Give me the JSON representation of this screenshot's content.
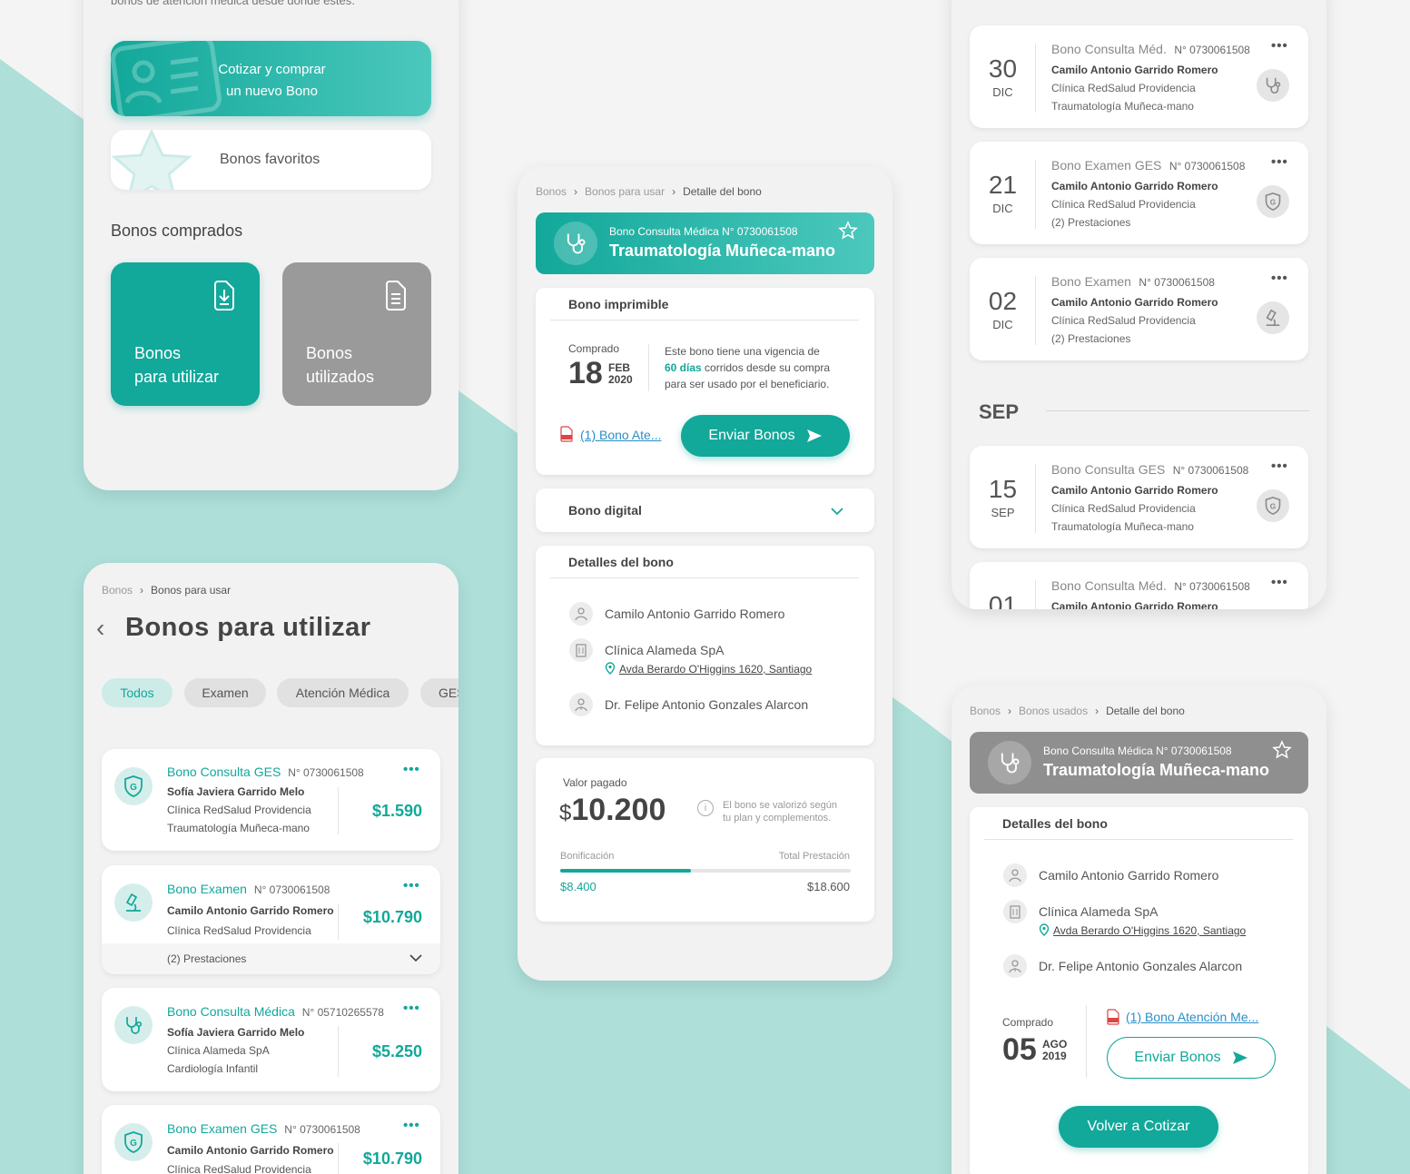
{
  "colors": {
    "accent": "#12a89a",
    "mint_bg": "#aedfd9",
    "grey_card": "#9a9a9a",
    "link": "#2a8fc7"
  },
  "home": {
    "intro_fragment": "bonos de atención médica desde donde estés.",
    "cotizar_line1": "Cotizar y comprar",
    "cotizar_line2": "un nuevo Bono",
    "favoritos": "Bonos favoritos",
    "comprados_title": "Bonos comprados",
    "tile_utilizar_1": "Bonos",
    "tile_utilizar_2": "para utilizar",
    "tile_utilizados_1": "Bonos",
    "tile_utilizados_2": "utilizados"
  },
  "list": {
    "breadcrumb": [
      "Bonos",
      "Bonos para usar"
    ],
    "title": "Bonos para utilizar",
    "chips": [
      "Todos",
      "Examen",
      "Atención Médica",
      "GES"
    ],
    "items": [
      {
        "type": "Bono Consulta GES",
        "num": "N° 0730061508",
        "person": "Sofía Javiera Garrido Melo",
        "clinic": "Clínica RedSalud Providencia",
        "spec": "Traumatología Muñeca-mano",
        "price": "$1.590",
        "icon": "shield-g-icon"
      },
      {
        "type": "Bono Examen",
        "num": "N° 0730061508",
        "person": "Camilo Antonio Garrido Romero",
        "clinic": "Clínica RedSalud Providencia",
        "spec": "(2) Prestaciones",
        "price": "$10.790",
        "icon": "microscope-icon"
      },
      {
        "type": "Bono Consulta Médica",
        "num": "N° 05710265578",
        "person": "Sofía Javiera Garrido Melo",
        "clinic": "Clínica Alameda SpA",
        "spec": "Cardiología Infantil",
        "price": "$5.250",
        "icon": "stethoscope-icon"
      },
      {
        "type": "Bono Examen GES",
        "num": "N° 0730061508",
        "person": "Camilo Antonio Garrido Romero",
        "clinic": "Clínica RedSalud Providencia",
        "spec": "",
        "price": "$10.790",
        "icon": "shield-g-icon"
      }
    ]
  },
  "detail": {
    "breadcrumb": [
      "Bonos",
      "Bonos para usar",
      "Detalle del bono"
    ],
    "header_sub": "Bono Consulta Médica N° 0730061508",
    "header_title": "Traumatología Muñeca-mano",
    "imprimible": "Bono imprimible",
    "comprado": "Comprado",
    "day": "18",
    "month": "FEB",
    "year": "2020",
    "vig_1": "Este bono tiene una vigencia de",
    "vig_days": "60 días",
    "vig_2": " corridos desde su compra",
    "vig_3": "para ser usado por el beneficiario.",
    "pdf_link": "(1) Bono Ate...",
    "enviar": "Enviar Bonos",
    "digital": "Bono digital",
    "detalles": "Detalles del bono",
    "patient": "Camilo Antonio Garrido Romero",
    "clinic": "Clínica Alameda SpA",
    "address": "Avda Berardo O'Higgins 1620, Santiago",
    "doctor": "Dr. Felipe Antonio Gonzales Alarcon",
    "valor_label": "Valor pagado",
    "valor_currency": "$",
    "valor": "10.200",
    "valor_note_1": "El bono se valorizó según",
    "valor_note_2": "tu plan y complementos.",
    "bonificacion": "Bonificación",
    "total_label": "Total Prestación",
    "bonif_value": "$8.400",
    "total_value": "$18.600",
    "bonif_fraction": 0.45
  },
  "used": {
    "items": [
      {
        "day": "30",
        "mon": "DIC",
        "type": "Bono Consulta Méd.",
        "num": "N° 0730061508",
        "person": "Camilo Antonio Garrido Romero",
        "clinic": "Clínica RedSalud Providencia",
        "spec": "Traumatología Muñeca-mano",
        "icon": "stethoscope-icon"
      },
      {
        "day": "21",
        "mon": "DIC",
        "type": "Bono Examen GES",
        "num": "N° 0730061508",
        "person": "Camilo Antonio Garrido Romero",
        "clinic": "Clínica RedSalud Providencia",
        "spec": "(2) Prestaciones",
        "icon": "shield-g-icon"
      },
      {
        "day": "02",
        "mon": "DIC",
        "type": "Bono Examen",
        "num": "N° 0730061508",
        "person": "Camilo Antonio Garrido Romero",
        "clinic": "Clínica RedSalud Providencia",
        "spec": "(2) Prestaciones",
        "icon": "microscope-icon"
      },
      {
        "day": "15",
        "mon": "SEP",
        "type": "Bono Consulta GES",
        "num": "N° 0730061508",
        "person": "Camilo Antonio Garrido Romero",
        "clinic": "Clínica RedSalud Providencia",
        "spec": "Traumatología Muñeca-mano",
        "icon": "shield-g-icon"
      },
      {
        "day": "01",
        "mon": "",
        "type": "Bono Consulta Méd.",
        "num": "N° 0730061508",
        "person": "Camilo Antonio Garrido Romero",
        "clinic": "",
        "spec": "",
        "icon": ""
      }
    ],
    "month_sep": "SEP"
  },
  "used_detail": {
    "breadcrumb": [
      "Bonos",
      "Bonos usados",
      "Detalle del bono"
    ],
    "header_sub": "Bono Consulta Médica N° 0730061508",
    "header_title": "Traumatología Muñeca-mano",
    "detalles": "Detalles del bono",
    "patient": "Camilo Antonio Garrido Romero",
    "clinic": "Clínica Alameda SpA",
    "address": "Avda Berardo O'Higgins 1620, Santiago",
    "doctor": "Dr. Felipe Antonio Gonzales Alarcon",
    "comprado": "Comprado",
    "day": "05",
    "month": "AGO",
    "year": "2019",
    "pdf_link": "(1) Bono Atención Me...",
    "enviar": "Enviar Bonos",
    "volver": "Volver a Cotizar"
  }
}
